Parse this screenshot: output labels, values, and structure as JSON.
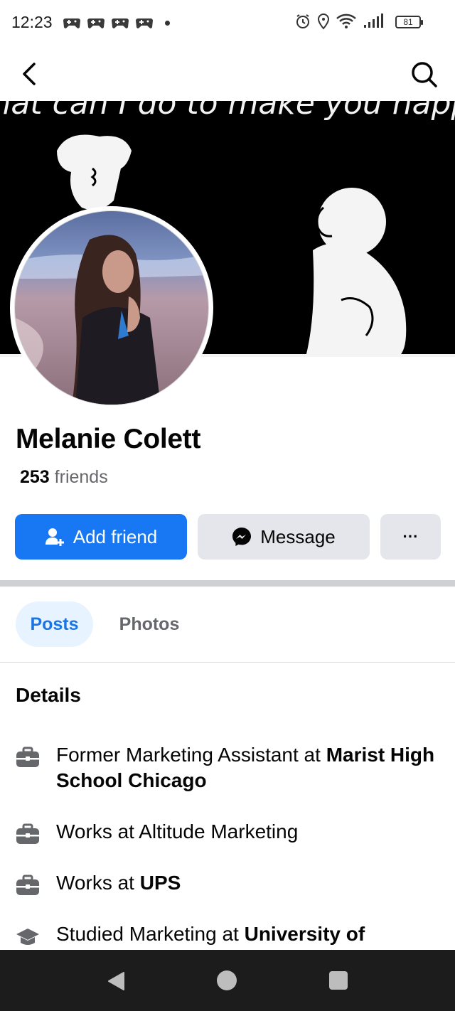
{
  "status_bar": {
    "time": "12:23",
    "battery": "81"
  },
  "cover": {
    "caption": "what can I do to make you happy"
  },
  "profile": {
    "name": "Melanie Colett",
    "friends_count": "253",
    "friends_label": "friends"
  },
  "actions": {
    "add_friend": "Add friend",
    "message": "Message",
    "more": "···"
  },
  "tabs": [
    {
      "label": "Posts",
      "active": true
    },
    {
      "label": "Photos",
      "active": false
    }
  ],
  "details": {
    "title": "Details",
    "items": [
      {
        "icon": "briefcase-icon",
        "prefix": "Former Marketing Assistant at ",
        "bold": "Marist High School Chicago"
      },
      {
        "icon": "briefcase-icon",
        "prefix": "Works at Altitude Marketing",
        "bold": ""
      },
      {
        "icon": "briefcase-icon",
        "prefix": "Works at ",
        "bold": "UPS"
      },
      {
        "icon": "graduation-cap-icon",
        "prefix": "Studied Marketing at ",
        "bold": "University of"
      }
    ]
  },
  "colors": {
    "primary": "#1877f2",
    "secondary_button": "#e4e6eb",
    "tab_active_bg": "#e7f3ff",
    "tab_active_text": "#1b74e4",
    "muted_text": "#65676b"
  }
}
